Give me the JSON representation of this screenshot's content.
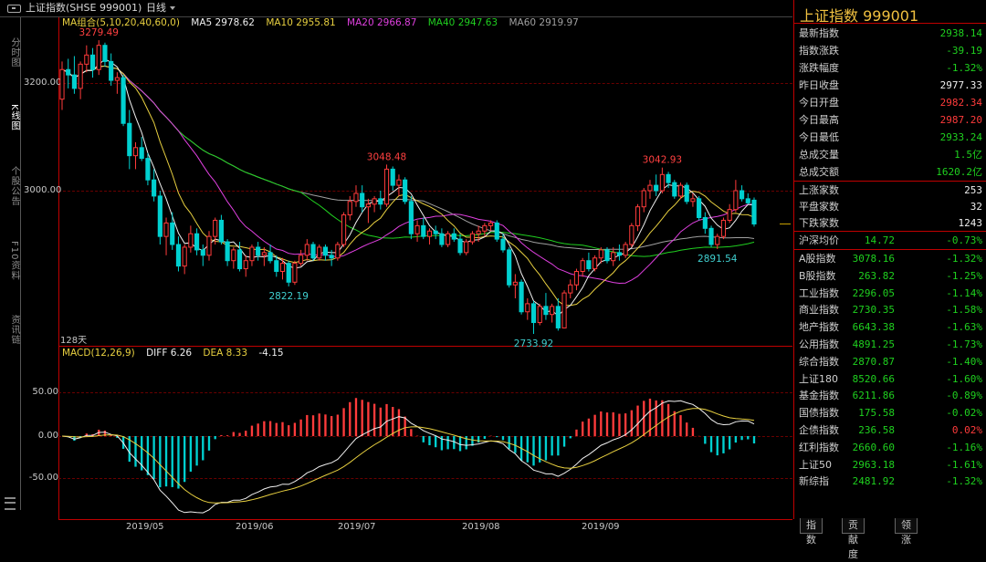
{
  "header": {
    "title": "上证指数(SHSE 999001)",
    "period": "日线"
  },
  "left_tabs": [
    {
      "label": "分时图",
      "active": false
    },
    {
      "label": "K线图",
      "active": true
    },
    {
      "label": "个股公告",
      "active": false
    },
    {
      "label": "F10资料",
      "active": false
    },
    {
      "label": "资讯链",
      "active": false
    }
  ],
  "legend_main": {
    "label": "MA组合(5,10,20,40,60,0)",
    "items": [
      {
        "text": "MA5 2978.62",
        "color": "#f0f0f0"
      },
      {
        "text": "MA10 2955.81",
        "color": "#e8d040"
      },
      {
        "text": "MA20 2966.87",
        "color": "#e040e0"
      },
      {
        "text": "MA40 2947.63",
        "color": "#20d020"
      },
      {
        "text": "MA60 2919.97",
        "color": "#a0a0a0"
      }
    ]
  },
  "legend_macd": {
    "label": "MACD(12,26,9)",
    "items": [
      {
        "text": "DIFF 6.26",
        "color": "#f0f0f0"
      },
      {
        "text": "DEA 8.33",
        "color": "#e8d040"
      },
      {
        "text": "-4.15",
        "color": "#f0f0f0"
      }
    ]
  },
  "y_axis_price": [
    "3200.00",
    "3000.00"
  ],
  "y_axis_macd": [
    "50.00",
    "0.00",
    "-50.00"
  ],
  "days_label": "128天",
  "x_axis": [
    "2019/05",
    "2019/06",
    "2019/07",
    "2019/08",
    "2019/09"
  ],
  "annotations": [
    {
      "text": "3279.49",
      "color": "#ff4040"
    },
    {
      "text": "2822.19",
      "color": "#40d0d0"
    },
    {
      "text": "3048.48",
      "color": "#ff4040"
    },
    {
      "text": "2733.92",
      "color": "#40d0d0"
    },
    {
      "text": "3042.93",
      "color": "#ff4040"
    },
    {
      "text": "2891.54",
      "color": "#40d0d0"
    }
  ],
  "sidebar": {
    "title": "上证指数  999001",
    "quote": [
      {
        "k": "最新指数",
        "v": "2938.14",
        "c": "green"
      },
      {
        "k": "指数涨跌",
        "v": "-39.19",
        "c": "green"
      },
      {
        "k": "涨跌幅度",
        "v": "-1.32%",
        "c": "green"
      },
      {
        "k": "昨日收盘",
        "v": "2977.33",
        "c": "white"
      },
      {
        "k": "今日开盘",
        "v": "2982.34",
        "c": "red"
      },
      {
        "k": "今日最高",
        "v": "2987.20",
        "c": "red"
      },
      {
        "k": "今日最低",
        "v": "2933.24",
        "c": "green"
      },
      {
        "k": "总成交量",
        "v": "1.5亿",
        "c": "green"
      },
      {
        "k": "总成交额",
        "v": "1620.2亿",
        "c": "green"
      }
    ],
    "breadth": [
      {
        "k": "上涨家数",
        "v": "253",
        "c": "white"
      },
      {
        "k": "平盘家数",
        "v": "32",
        "c": "white"
      },
      {
        "k": "下跌家数",
        "v": "1243",
        "c": "white"
      }
    ],
    "hs_avg": {
      "k": "沪深均价",
      "v1": "14.72",
      "v2": "-0.73%"
    },
    "indices": [
      {
        "k": "A股指数",
        "v1": "3078.16",
        "v2": "-1.32%",
        "c": "green"
      },
      {
        "k": "B股指数",
        "v1": "263.82",
        "v2": "-1.25%",
        "c": "green"
      },
      {
        "k": "工业指数",
        "v1": "2296.05",
        "v2": "-1.14%",
        "c": "green"
      },
      {
        "k": "商业指数",
        "v1": "2730.35",
        "v2": "-1.58%",
        "c": "green"
      },
      {
        "k": "地产指数",
        "v1": "6643.38",
        "v2": "-1.63%",
        "c": "green"
      },
      {
        "k": "公用指数",
        "v1": "4891.25",
        "v2": "-1.73%",
        "c": "green"
      },
      {
        "k": "综合指数",
        "v1": "2870.87",
        "v2": "-1.40%",
        "c": "green"
      },
      {
        "k": "上证180",
        "v1": "8520.66",
        "v2": "-1.60%",
        "c": "green"
      },
      {
        "k": "基金指数",
        "v1": "6211.86",
        "v2": "-0.89%",
        "c": "green"
      },
      {
        "k": "国债指数",
        "v1": "175.58",
        "v2": "-0.02%",
        "c": "green"
      },
      {
        "k": "企债指数",
        "v1": "236.58",
        "v2": "0.02%",
        "c": "red"
      },
      {
        "k": "红利指数",
        "v1": "2660.60",
        "v2": "-1.16%",
        "c": "green"
      },
      {
        "k": "上证50",
        "v1": "2963.18",
        "v2": "-1.61%",
        "c": "green"
      },
      {
        "k": "新综指",
        "v1": "2481.92",
        "v2": "-1.32%",
        "c": "green"
      }
    ]
  },
  "bottom_tabs": [
    "指数",
    "贡献度",
    "领涨"
  ],
  "colors": {
    "up": "#ff3b3b",
    "down": "#00d0d0",
    "ma5": "#f0f0f0",
    "ma10": "#e8d040",
    "ma20": "#e040e0",
    "ma40": "#20d020",
    "ma60": "#a0a0a0",
    "grid": "#6a0000",
    "frame": "#c00000"
  },
  "chart_data": [
    {
      "type": "candlestick",
      "title": "上证指数(SHSE 999001) 日线",
      "x_range": [
        "2019/04",
        "2019/09"
      ],
      "ylim": [
        2700,
        3320
      ],
      "y_ticks": [
        3200,
        3000
      ],
      "x_ticks": [
        "2019/05",
        "2019/06",
        "2019/07",
        "2019/08",
        "2019/09"
      ],
      "bars": [
        {
          "o": 3170,
          "h": 3240,
          "l": 3150,
          "c": 3225
        },
        {
          "o": 3225,
          "h": 3245,
          "l": 3190,
          "c": 3215
        },
        {
          "o": 3215,
          "h": 3250,
          "l": 3180,
          "c": 3190
        },
        {
          "o": 3190,
          "h": 3240,
          "l": 3170,
          "c": 3235
        },
        {
          "o": 3235,
          "h": 3270,
          "l": 3220,
          "c": 3252
        },
        {
          "o": 3252,
          "h": 3265,
          "l": 3210,
          "c": 3225
        },
        {
          "o": 3225,
          "h": 3279.49,
          "l": 3215,
          "c": 3270
        },
        {
          "o": 3270,
          "h": 3275,
          "l": 3230,
          "c": 3240
        },
        {
          "o": 3240,
          "h": 3255,
          "l": 3195,
          "c": 3205
        },
        {
          "o": 3205,
          "h": 3220,
          "l": 3180,
          "c": 3210
        },
        {
          "o": 3210,
          "h": 3215,
          "l": 3120,
          "c": 3125
        },
        {
          "o": 3125,
          "h": 3150,
          "l": 3040,
          "c": 3065
        },
        {
          "o": 3065,
          "h": 3090,
          "l": 3040,
          "c": 3080
        },
        {
          "o": 3080,
          "h": 3100,
          "l": 3055,
          "c": 3060
        },
        {
          "o": 3060,
          "h": 3070,
          "l": 3010,
          "c": 3020
        },
        {
          "o": 3020,
          "h": 3040,
          "l": 2980,
          "c": 2990
        },
        {
          "o": 2990,
          "h": 3000,
          "l": 2900,
          "c": 2915
        },
        {
          "o": 2915,
          "h": 2950,
          "l": 2880,
          "c": 2940
        },
        {
          "o": 2940,
          "h": 2960,
          "l": 2890,
          "c": 2900
        },
        {
          "o": 2900,
          "h": 2915,
          "l": 2850,
          "c": 2860
        },
        {
          "o": 2860,
          "h": 2900,
          "l": 2845,
          "c": 2895
        },
        {
          "o": 2895,
          "h": 2935,
          "l": 2885,
          "c": 2920
        },
        {
          "o": 2920,
          "h": 2930,
          "l": 2880,
          "c": 2890
        },
        {
          "o": 2890,
          "h": 2900,
          "l": 2860,
          "c": 2880
        },
        {
          "o": 2880,
          "h": 2925,
          "l": 2870,
          "c": 2915
        },
        {
          "o": 2915,
          "h": 2950,
          "l": 2900,
          "c": 2945
        },
        {
          "o": 2945,
          "h": 2955,
          "l": 2900,
          "c": 2905
        },
        {
          "o": 2905,
          "h": 2910,
          "l": 2860,
          "c": 2870
        },
        {
          "o": 2870,
          "h": 2895,
          "l": 2855,
          "c": 2890
        },
        {
          "o": 2890,
          "h": 2905,
          "l": 2850,
          "c": 2855
        },
        {
          "o": 2855,
          "h": 2880,
          "l": 2840,
          "c": 2870
        },
        {
          "o": 2870,
          "h": 2900,
          "l": 2860,
          "c": 2895
        },
        {
          "o": 2895,
          "h": 2905,
          "l": 2870,
          "c": 2880
        },
        {
          "o": 2880,
          "h": 2895,
          "l": 2860,
          "c": 2885
        },
        {
          "o": 2885,
          "h": 2900,
          "l": 2865,
          "c": 2870
        },
        {
          "o": 2870,
          "h": 2880,
          "l": 2840,
          "c": 2850
        },
        {
          "o": 2850,
          "h": 2875,
          "l": 2835,
          "c": 2865
        },
        {
          "o": 2865,
          "h": 2870,
          "l": 2822.19,
          "c": 2830
        },
        {
          "o": 2830,
          "h": 2870,
          "l": 2825,
          "c": 2865
        },
        {
          "o": 2865,
          "h": 2890,
          "l": 2860,
          "c": 2880
        },
        {
          "o": 2880,
          "h": 2910,
          "l": 2870,
          "c": 2900
        },
        {
          "o": 2900,
          "h": 2905,
          "l": 2870,
          "c": 2875
        },
        {
          "o": 2875,
          "h": 2900,
          "l": 2870,
          "c": 2895
        },
        {
          "o": 2895,
          "h": 2900,
          "l": 2870,
          "c": 2880
        },
        {
          "o": 2880,
          "h": 2890,
          "l": 2860,
          "c": 2875
        },
        {
          "o": 2875,
          "h": 2905,
          "l": 2870,
          "c": 2900
        },
        {
          "o": 2900,
          "h": 2960,
          "l": 2895,
          "c": 2955
        },
        {
          "o": 2955,
          "h": 2990,
          "l": 2945,
          "c": 2980
        },
        {
          "o": 2980,
          "h": 3010,
          "l": 2970,
          "c": 2995
        },
        {
          "o": 2995,
          "h": 3010,
          "l": 2960,
          "c": 2970
        },
        {
          "o": 2970,
          "h": 2985,
          "l": 2940,
          "c": 2975
        },
        {
          "o": 2975,
          "h": 2990,
          "l": 2960,
          "c": 2985
        },
        {
          "o": 2985,
          "h": 3000,
          "l": 2965,
          "c": 2975
        },
        {
          "o": 2975,
          "h": 3048.48,
          "l": 2970,
          "c": 3040
        },
        {
          "o": 3040,
          "h": 3045,
          "l": 3000,
          "c": 3010
        },
        {
          "o": 3010,
          "h": 3030,
          "l": 2990,
          "c": 3020
        },
        {
          "o": 3020,
          "h": 3025,
          "l": 2975,
          "c": 2980
        },
        {
          "o": 2980,
          "h": 2990,
          "l": 2910,
          "c": 2920
        },
        {
          "o": 2920,
          "h": 2945,
          "l": 2905,
          "c": 2935
        },
        {
          "o": 2935,
          "h": 2950,
          "l": 2910,
          "c": 2915
        },
        {
          "o": 2915,
          "h": 2930,
          "l": 2900,
          "c": 2925
        },
        {
          "o": 2925,
          "h": 2935,
          "l": 2910,
          "c": 2920
        },
        {
          "o": 2920,
          "h": 2930,
          "l": 2895,
          "c": 2900
        },
        {
          "o": 2900,
          "h": 2925,
          "l": 2895,
          "c": 2920
        },
        {
          "o": 2920,
          "h": 2930,
          "l": 2905,
          "c": 2910
        },
        {
          "o": 2910,
          "h": 2920,
          "l": 2880,
          "c": 2885
        },
        {
          "o": 2885,
          "h": 2910,
          "l": 2880,
          "c": 2905
        },
        {
          "o": 2905,
          "h": 2925,
          "l": 2900,
          "c": 2920
        },
        {
          "o": 2920,
          "h": 2935,
          "l": 2905,
          "c": 2925
        },
        {
          "o": 2925,
          "h": 2940,
          "l": 2915,
          "c": 2935
        },
        {
          "o": 2935,
          "h": 2945,
          "l": 2925,
          "c": 2940
        },
        {
          "o": 2940,
          "h": 2945,
          "l": 2905,
          "c": 2910
        },
        {
          "o": 2910,
          "h": 2920,
          "l": 2885,
          "c": 2890
        },
        {
          "o": 2890,
          "h": 2895,
          "l": 2820,
          "c": 2825
        },
        {
          "o": 2825,
          "h": 2845,
          "l": 2800,
          "c": 2830
        },
        {
          "o": 2830,
          "h": 2835,
          "l": 2770,
          "c": 2775
        },
        {
          "o": 2775,
          "h": 2800,
          "l": 2760,
          "c": 2790
        },
        {
          "o": 2790,
          "h": 2795,
          "l": 2733.92,
          "c": 2755
        },
        {
          "o": 2755,
          "h": 2790,
          "l": 2750,
          "c": 2785
        },
        {
          "o": 2785,
          "h": 2810,
          "l": 2760,
          "c": 2770
        },
        {
          "o": 2770,
          "h": 2790,
          "l": 2755,
          "c": 2785
        },
        {
          "o": 2785,
          "h": 2800,
          "l": 2740,
          "c": 2745
        },
        {
          "o": 2745,
          "h": 2815,
          "l": 2745,
          "c": 2810
        },
        {
          "o": 2810,
          "h": 2835,
          "l": 2800,
          "c": 2825
        },
        {
          "o": 2825,
          "h": 2855,
          "l": 2815,
          "c": 2850
        },
        {
          "o": 2850,
          "h": 2875,
          "l": 2840,
          "c": 2870
        },
        {
          "o": 2870,
          "h": 2885,
          "l": 2850,
          "c": 2855
        },
        {
          "o": 2855,
          "h": 2880,
          "l": 2850,
          "c": 2875
        },
        {
          "o": 2875,
          "h": 2895,
          "l": 2865,
          "c": 2890
        },
        {
          "o": 2890,
          "h": 2895,
          "l": 2865,
          "c": 2870
        },
        {
          "o": 2870,
          "h": 2895,
          "l": 2860,
          "c": 2885
        },
        {
          "o": 2885,
          "h": 2900,
          "l": 2870,
          "c": 2880
        },
        {
          "o": 2880,
          "h": 2905,
          "l": 2875,
          "c": 2900
        },
        {
          "o": 2900,
          "h": 2940,
          "l": 2895,
          "c": 2935
        },
        {
          "o": 2935,
          "h": 2975,
          "l": 2925,
          "c": 2970
        },
        {
          "o": 2970,
          "h": 3005,
          "l": 2960,
          "c": 3000
        },
        {
          "o": 3000,
          "h": 3020,
          "l": 2985,
          "c": 3010
        },
        {
          "o": 3010,
          "h": 3030,
          "l": 2990,
          "c": 3000
        },
        {
          "o": 3000,
          "h": 3042.93,
          "l": 2995,
          "c": 3030
        },
        {
          "o": 3030,
          "h": 3035,
          "l": 3005,
          "c": 3015
        },
        {
          "o": 3015,
          "h": 3020,
          "l": 2985,
          "c": 2990
        },
        {
          "o": 2990,
          "h": 3015,
          "l": 2985,
          "c": 3010
        },
        {
          "o": 3010,
          "h": 3015,
          "l": 2975,
          "c": 2980
        },
        {
          "o": 2980,
          "h": 2995,
          "l": 2970,
          "c": 2985
        },
        {
          "o": 2985,
          "h": 2990,
          "l": 2945,
          "c": 2950
        },
        {
          "o": 2950,
          "h": 2960,
          "l": 2920,
          "c": 2930
        },
        {
          "o": 2930,
          "h": 2935,
          "l": 2895,
          "c": 2900
        },
        {
          "o": 2900,
          "h": 2920,
          "l": 2891.54,
          "c": 2915
        },
        {
          "o": 2915,
          "h": 2950,
          "l": 2910,
          "c": 2945
        },
        {
          "o": 2945,
          "h": 2975,
          "l": 2940,
          "c": 2965
        },
        {
          "o": 2965,
          "h": 3020,
          "l": 2960,
          "c": 3000
        },
        {
          "o": 3000,
          "h": 3010,
          "l": 2980,
          "c": 2985
        },
        {
          "o": 2985,
          "h": 2995,
          "l": 2975,
          "c": 2977.33
        },
        {
          "o": 2982.34,
          "h": 2987.2,
          "l": 2933.24,
          "c": 2938.14
        }
      ],
      "series": [
        {
          "name": "MA5",
          "value": 2978.62
        },
        {
          "name": "MA10",
          "value": 2955.81
        },
        {
          "name": "MA20",
          "value": 2966.87
        },
        {
          "name": "MA40",
          "value": 2947.63
        },
        {
          "name": "MA60",
          "value": 2919.97
        }
      ],
      "annotations": [
        {
          "text": "3279.49",
          "kind": "high"
        },
        {
          "text": "2822.19",
          "kind": "low"
        },
        {
          "text": "3048.48",
          "kind": "high"
        },
        {
          "text": "2733.92",
          "kind": "low"
        },
        {
          "text": "3042.93",
          "kind": "high"
        },
        {
          "text": "2891.54",
          "kind": "low"
        }
      ],
      "grid": true
    },
    {
      "type": "bar",
      "title": "MACD(12,26,9)",
      "ylim": [
        -75,
        75
      ],
      "y_ticks": [
        50,
        0,
        -50
      ],
      "series": [
        {
          "name": "DIFF",
          "value": 6.26
        },
        {
          "name": "DEA",
          "value": 8.33
        },
        {
          "name": "MACD",
          "value": -4.15
        }
      ],
      "grid": true
    }
  ]
}
